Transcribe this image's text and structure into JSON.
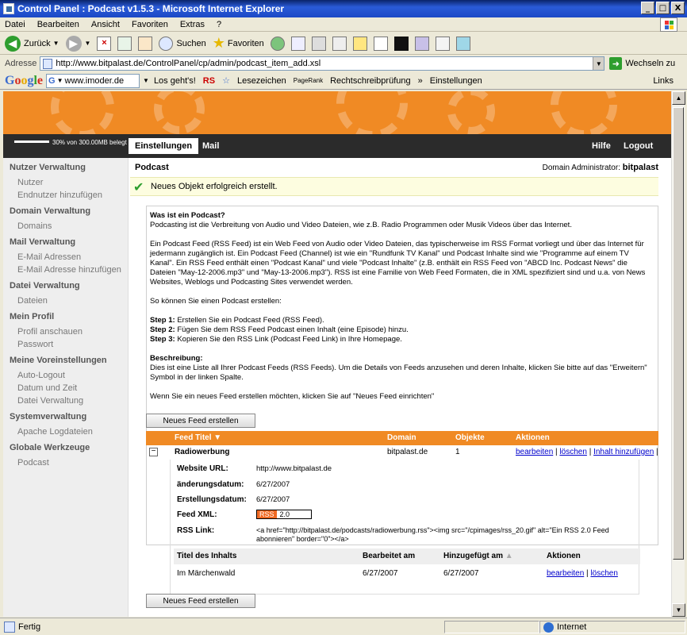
{
  "window": {
    "title": "Control Panel : Podcast v1.5.3 - Microsoft Internet Explorer",
    "buttons": {
      "minimize": "_",
      "maximize": "□",
      "close": "X"
    }
  },
  "menu": [
    "Datei",
    "Bearbeiten",
    "Ansicht",
    "Favoriten",
    "Extras",
    "?"
  ],
  "toolbar": {
    "back": "Zurück",
    "search": "Suchen",
    "favorites": "Favoriten"
  },
  "address": {
    "label": "Adresse",
    "url": "http://www.bitpalast.de/ControlPanel/cp/admin/podcast_item_add.xsl",
    "go": "Wechseln zu"
  },
  "google": {
    "logo": [
      "G",
      "o",
      "o",
      "g",
      "l",
      "e"
    ],
    "input": "www.imoder.de",
    "go": "Los geht's!",
    "rs": "RS",
    "bookmarks": "Lesezeichen",
    "pagerank": "PageRank",
    "spellcheck": "Rechtschreibprüfung",
    "more": "»",
    "settings": "Einstellungen",
    "links": "Links"
  },
  "page": {
    "quota": "30% von 300.00MB belegt",
    "quota_fraction": 0.3,
    "nav": {
      "settings": "Einstellungen",
      "mail": "Mail",
      "help": "Hilfe",
      "logout": "Logout"
    },
    "sidebar": [
      {
        "title": "Nutzer Verwaltung",
        "links": [
          "Nutzer",
          "Endnutzer hinzufügen"
        ]
      },
      {
        "title": "Domain Verwaltung",
        "links": [
          "Domains"
        ]
      },
      {
        "title": "Mail Verwaltung",
        "links": [
          "E-Mail Adressen",
          "E-Mail Adresse hinzufügen"
        ]
      },
      {
        "title": "Datei Verwaltung",
        "links": [
          "Dateien"
        ]
      },
      {
        "title": "Mein Profil",
        "links": [
          "Profil anschauen",
          "Passwort"
        ]
      },
      {
        "title": "Meine Voreinstellungen",
        "links": [
          "Auto-Logout",
          "Datum und Zeit",
          "Datei Verwaltung"
        ]
      },
      {
        "title": "Systemverwaltung",
        "links": [
          "Apache Logdateien"
        ]
      },
      {
        "title": "Globale Werkzeuge",
        "links": [
          "Podcast"
        ]
      }
    ],
    "title": "Podcast",
    "admin_label": "Domain Administrator:",
    "admin_user": "bitpalast",
    "success": "Neues Objekt erfolgreich erstellt.",
    "info": {
      "q_title": "Was ist ein Podcast?",
      "q_text": "Podcasting ist die Verbreitung von Audio und Video Dateien, wie z.B. Radio Programmen oder Musik Videos über das Internet.",
      "p2": "Ein Podcast Feed (RSS Feed) ist ein Web Feed von Audio oder Video Dateien, das typischerweise im RSS Format vorliegt und über das Internet für jedermann zugänglich ist. Ein Podcast Feed (Channel) ist wie ein \"Rundfunk TV Kanal\" und Podcast Inhalte sind wie \"Programme auf einem TV Kanal\". Ein RSS Feed enthält einen \"Podcast Kanal\" und viele \"Podcast Inhalte\" (z.B. enthält ein RSS Feed von \"ABCD Inc. Podcast News\" die Dateien \"May-12-2006.mp3\" und \"May-13-2006.mp3\"). RSS ist eine Familie von Web Feed Formaten, die in XML spezifiziert sind und u.a. von News Websites, Weblogs und Podcasting Sites verwendet werden.",
      "p3": "So können Sie einen Podcast erstellen:",
      "step1_label": "Step 1:",
      "step1": "Erstellen Sie ein Podcast Feed (RSS Feed).",
      "step2_label": "Step 2:",
      "step2": "Fügen Sie dem RSS Feed Podcast einen Inhalt (eine Episode) hinzu.",
      "step3_label": "Step 3:",
      "step3": "Kopieren Sie den RSS Link (Podcast Feed Link) in Ihre Homepage.",
      "desc_title": "Beschreibung:",
      "desc": "Dies ist eine Liste all Ihrer Podcast Feeds (RSS Feeds). Um die Details von Feeds anzusehen und deren Inhalte, klicken Sie bitte auf das \"Erweitern\" Symbol in der linken Spalte.",
      "new_hint": "Wenn Sie ein neues Feed erstellen möchten, klicken Sie auf \"Neues Feed einrichten\""
    },
    "new_feed_button": "Neues Feed erstellen",
    "feeds_table": {
      "headers": {
        "title": "Feed Titel",
        "domain": "Domain",
        "objects": "Objekte",
        "actions": "Aktionen"
      },
      "sort_icon": "sort-down-icon",
      "row": {
        "toggle": "−",
        "title": "Radiowerbung",
        "domain": "bitpalast.de",
        "objects": "1",
        "actions": [
          "bearbeiten",
          "löschen",
          "Inhalt hinzufügen"
        ],
        "sep": "|"
      }
    },
    "detail": {
      "website_label": "Website URL:",
      "website": "http://www.bitpalast.de",
      "changed_label": "änderungsdatum:",
      "changed": "6/27/2007",
      "created_label": "Erstellungsdatum:",
      "created": "6/27/2007",
      "xml_label": "Feed XML:",
      "xml_badge_left": "RSS",
      "xml_badge_right": "2.0",
      "rss_label": "RSS Link:",
      "rss_code": "<a href=\"http://bitpalast.de/podcasts/radiowerbung.rss\"><img src=\"/cpimages/rss_20.gif\" alt=\"Ein RSS 2.0 Feed abonnieren\" border=\"0\"></a>"
    },
    "items_table": {
      "headers": {
        "title": "Titel des Inhalts",
        "edited": "Bearbeitet am",
        "added": "Hinzugefügt am",
        "actions": "Aktionen"
      },
      "row": {
        "title": "Im Märchenwald",
        "edited": "6/27/2007",
        "added": "6/27/2007",
        "actions": [
          "bearbeiten",
          "löschen"
        ]
      }
    }
  },
  "status": {
    "text": "Fertig",
    "zone": "Internet"
  }
}
